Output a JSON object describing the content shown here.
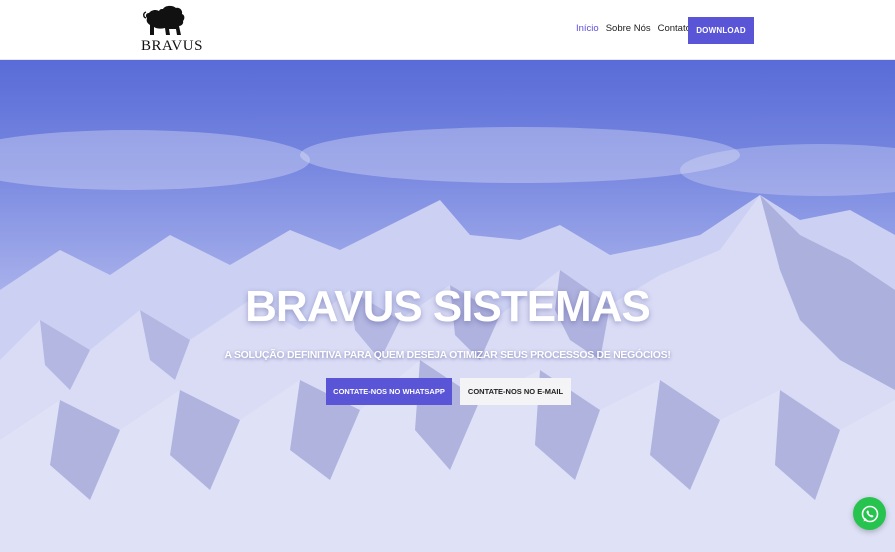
{
  "header": {
    "logo_text": "BRAVUS",
    "logo_icon": "lion-icon",
    "nav": [
      {
        "label": "Início",
        "active": true
      },
      {
        "label": "Sobre Nós",
        "active": false
      },
      {
        "label": "Contato",
        "active": false
      }
    ],
    "download_label": "DOWNLOAD"
  },
  "hero": {
    "title": "BRAVUS SISTEMAS",
    "subtitle": "A SOLUÇÃO DEFINITIVA PARA QUEM DESEJA OTIMIZAR SEUS PROCESSOS DE NEGÓCIOS!",
    "whatsapp_button": "CONTATE-NOS NO WHATSAPP",
    "email_button": "CONTATE-NOS NO E-MAIL",
    "background_icon": "snowy-mountains-image"
  },
  "floating": {
    "whatsapp_icon": "whatsapp-icon"
  },
  "colors": {
    "accent": "#5a54d6",
    "whatsapp": "#26c44f"
  }
}
